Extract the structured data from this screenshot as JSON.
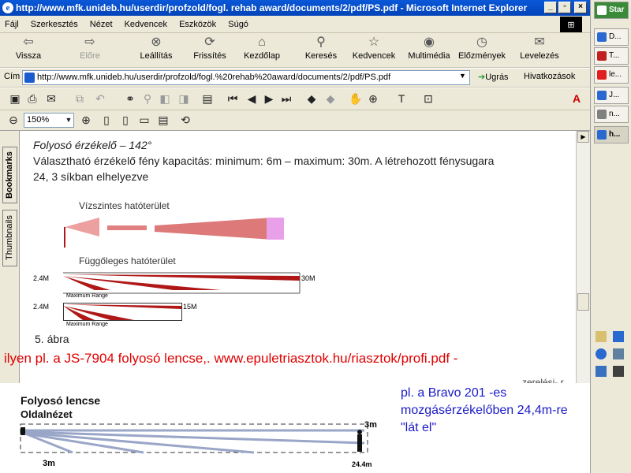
{
  "window": {
    "title": "http://www.mfk.unideb.hu/userdir/profzold/fogl. rehab award/documents/2/pdf/PS.pdf - Microsoft Internet Explorer"
  },
  "menu": [
    "Fájl",
    "Szerkesztés",
    "Nézet",
    "Kedvencek",
    "Eszközök",
    "Súgó"
  ],
  "toolbar": {
    "back": "Vissza",
    "forward": "Előre",
    "stop": "Leállítás",
    "refresh": "Frissítés",
    "home": "Kezdőlap",
    "search": "Keresés",
    "favorites": "Kedvencek",
    "media": "Multimédia",
    "history": "Előzmények",
    "mail": "Levelezés"
  },
  "address": {
    "label": "Cím",
    "url": "http://www.mfk.unideb.hu/userdir/profzold/fogl.%20rehab%20award/documents/2/pdf/PS.pdf",
    "go": "Ugrás",
    "links": "Hivatkozások"
  },
  "pdf": {
    "zoom": "150%",
    "tabs": [
      "Bookmarks",
      "Thumbnails"
    ]
  },
  "doc": {
    "heading": "Folyosó érzékelő  – 142°",
    "line1": "Választható érzékelő fény kapacitás: minimum: 6m – maximum: 30m. A létrehozott fénysugara",
    "line2": "24,  3 síkban elhelyezve",
    "horiz_label": "Vízszintes hatóterület",
    "vert_label": "Függőleges hatóterület",
    "h1": "2.4M",
    "r1": "30M",
    "h2": "2.4M",
    "r2": "15M",
    "max1": "Maximum Range",
    "max2": "Maximum Range",
    "fig": "5. ábra",
    "cut": "zerelési- r"
  },
  "overlay_red": "ilyen pl.  a  JS-7904 folyosó lencse,.  www.epuletriasztok.hu/riasztok/profi.pdf -",
  "bottom": {
    "title": "Folyosó lencse",
    "subtitle": "Oldalnézet",
    "h": "3m",
    "left": "3m",
    "right": "24.4m"
  },
  "overlay_blue": [
    "pl.  a  Bravo 201 -es",
    "mozgásérzékelőben 24,4m-re",
    "\"lát el\""
  ],
  "taskbar": {
    "start": "Star",
    "items": [
      "D...",
      "T...",
      "le...",
      "J...",
      "n...",
      "h..."
    ]
  },
  "colors": {
    "titlebar": "#0a58d8",
    "red": "#e00000",
    "blue": "#1a1ac8",
    "beam": "#b01818"
  }
}
